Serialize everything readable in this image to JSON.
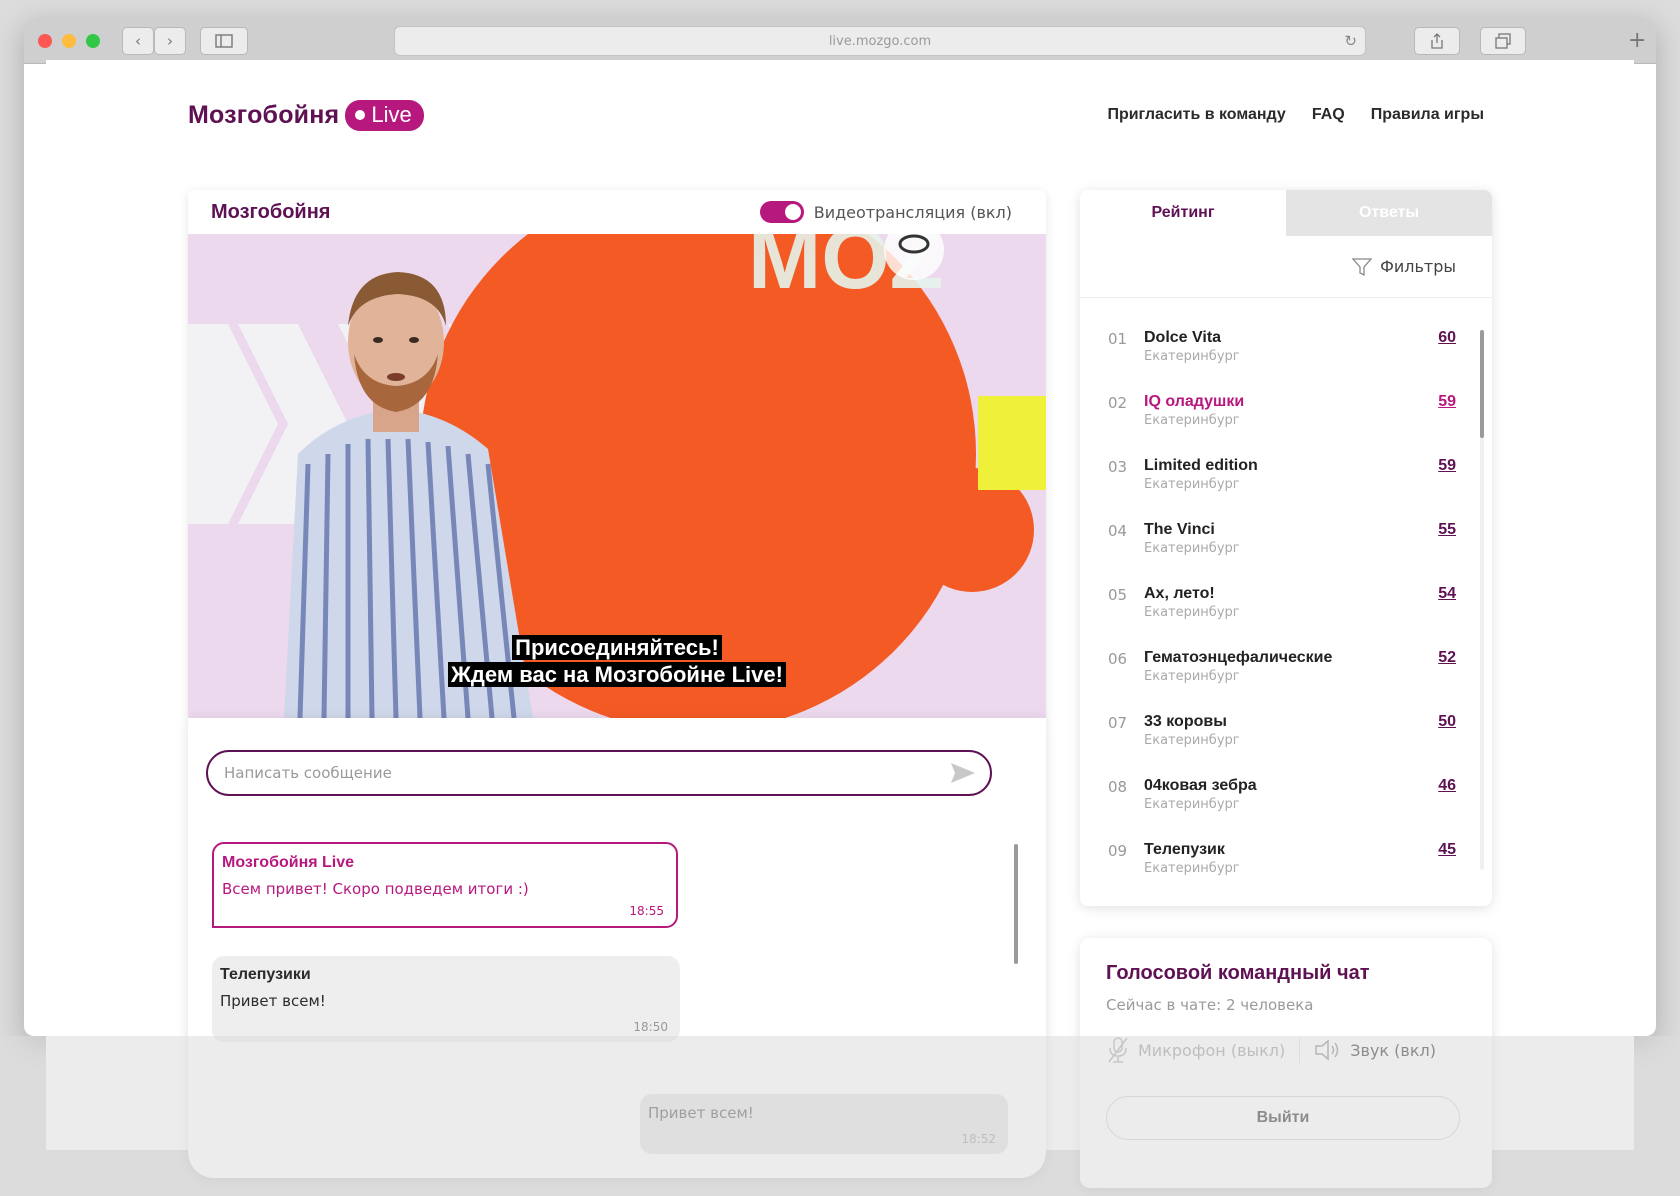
{
  "browser": {
    "url": "live.mozgo.com"
  },
  "logo": {
    "text": "Мозгобойня",
    "badge": "Live"
  },
  "nav": {
    "invite": "Пригласить в команду",
    "faq": "FAQ",
    "rules": "Правила игры"
  },
  "video": {
    "title": "Мозгобойня",
    "toggle_label": "Видеотрансляция (вкл)",
    "toggle_on": true,
    "subtitle_line1": "Присоединяйтесь!",
    "subtitle_line2": "Ждем вас на Мозгобойне Live!"
  },
  "chat": {
    "placeholder": "Написать сообщение",
    "messages": [
      {
        "author": "Мозгобойня Live",
        "text": "Всем привет! Скоро подведем итоги :)",
        "time": "18:55"
      },
      {
        "author": "Телепузики",
        "text": "Привет всем!",
        "time": "18:50"
      },
      {
        "text": "Привет всем!",
        "time": "18:52"
      }
    ]
  },
  "rating": {
    "tab_rating": "Рейтинг",
    "tab_answers": "Ответы",
    "filters": "Фильтры",
    "rows": [
      {
        "num": "01",
        "name": "Dolce Vita",
        "city": "Екатеринбург",
        "score": "60"
      },
      {
        "num": "02",
        "name": "IQ оладушки",
        "city": "Екатеринбург",
        "score": "59"
      },
      {
        "num": "03",
        "name": "Limited edition",
        "city": "Екатеринбург",
        "score": "59"
      },
      {
        "num": "04",
        "name": "The Vinci",
        "city": "Екатеринбург",
        "score": "55"
      },
      {
        "num": "05",
        "name": "Ах, лето!",
        "city": "Екатеринбург",
        "score": "54"
      },
      {
        "num": "06",
        "name": "Гематоэнцефалические",
        "city": "Екатеринбург",
        "score": "52"
      },
      {
        "num": "07",
        "name": "33 коровы",
        "city": "Екатеринбург",
        "score": "50"
      },
      {
        "num": "08",
        "name": "04ковая зебра",
        "city": "Екатеринбург",
        "score": "46"
      },
      {
        "num": "09",
        "name": "Телепузик",
        "city": "Екатеринбург",
        "score": "45"
      }
    ]
  },
  "voice": {
    "title": "Голосовой командный чат",
    "status": "Сейчас в чате: 2 человека",
    "mic_label": "Микрофон (выкл)",
    "sound_label": "Звук (вкл)",
    "exit_label": "Выйти"
  },
  "colors": {
    "brand_dark": "#5e1253",
    "brand_accent": "#b7187d"
  }
}
